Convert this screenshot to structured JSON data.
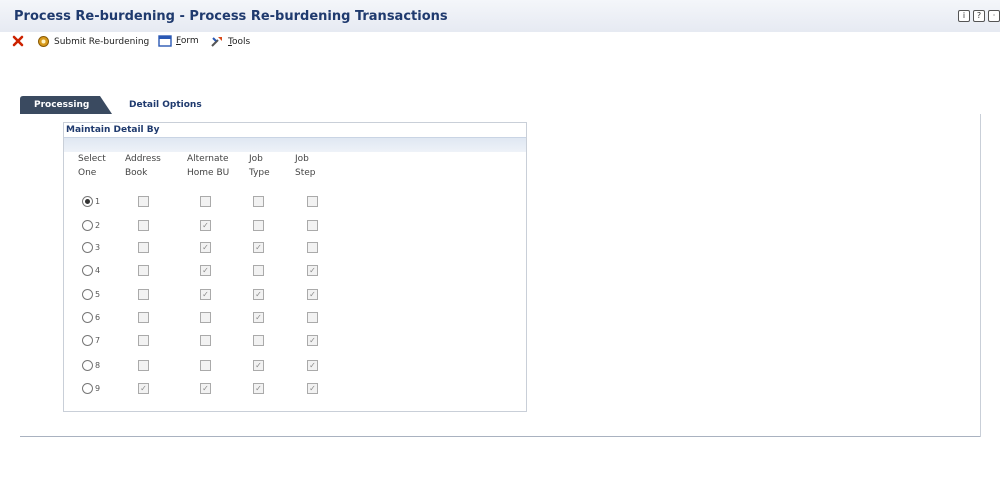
{
  "title": "Process Re-burdening - Process Re-burdening Transactions",
  "toolbar": {
    "submit_label": "Submit Re-burdening",
    "form_label_u": "F",
    "form_label_rest": "orm",
    "tools_label_u": "T",
    "tools_label_rest": "ools"
  },
  "tabs": {
    "processing": "Processing",
    "detail_options": "Detail Options"
  },
  "group": {
    "title": "Maintain Detail By"
  },
  "headers": {
    "select1": "Select",
    "select2": "One",
    "ab1": "Address",
    "ab2": "Book",
    "hb1": "Alternate",
    "hb2": "Home BU",
    "jt1": "Job",
    "jt2": "Type",
    "js1": "Job",
    "js2": "Step"
  },
  "rows": [
    {
      "n": "1",
      "selected": true,
      "address_book": false,
      "home_bu": false,
      "job_type": false,
      "job_step": false
    },
    {
      "n": "2",
      "selected": false,
      "address_book": false,
      "home_bu": true,
      "job_type": false,
      "job_step": false
    },
    {
      "n": "3",
      "selected": false,
      "address_book": false,
      "home_bu": true,
      "job_type": true,
      "job_step": false
    },
    {
      "n": "4",
      "selected": false,
      "address_book": false,
      "home_bu": true,
      "job_type": false,
      "job_step": true
    },
    {
      "n": "5",
      "selected": false,
      "address_book": false,
      "home_bu": true,
      "job_type": true,
      "job_step": true
    },
    {
      "n": "6",
      "selected": false,
      "address_book": false,
      "home_bu": false,
      "job_type": true,
      "job_step": false
    },
    {
      "n": "7",
      "selected": false,
      "address_book": false,
      "home_bu": false,
      "job_type": false,
      "job_step": true
    },
    {
      "n": "8",
      "selected": false,
      "address_book": false,
      "home_bu": false,
      "job_type": true,
      "job_step": true
    },
    {
      "n": "9",
      "selected": false,
      "address_book": true,
      "home_bu": true,
      "job_type": true,
      "job_step": true
    }
  ]
}
